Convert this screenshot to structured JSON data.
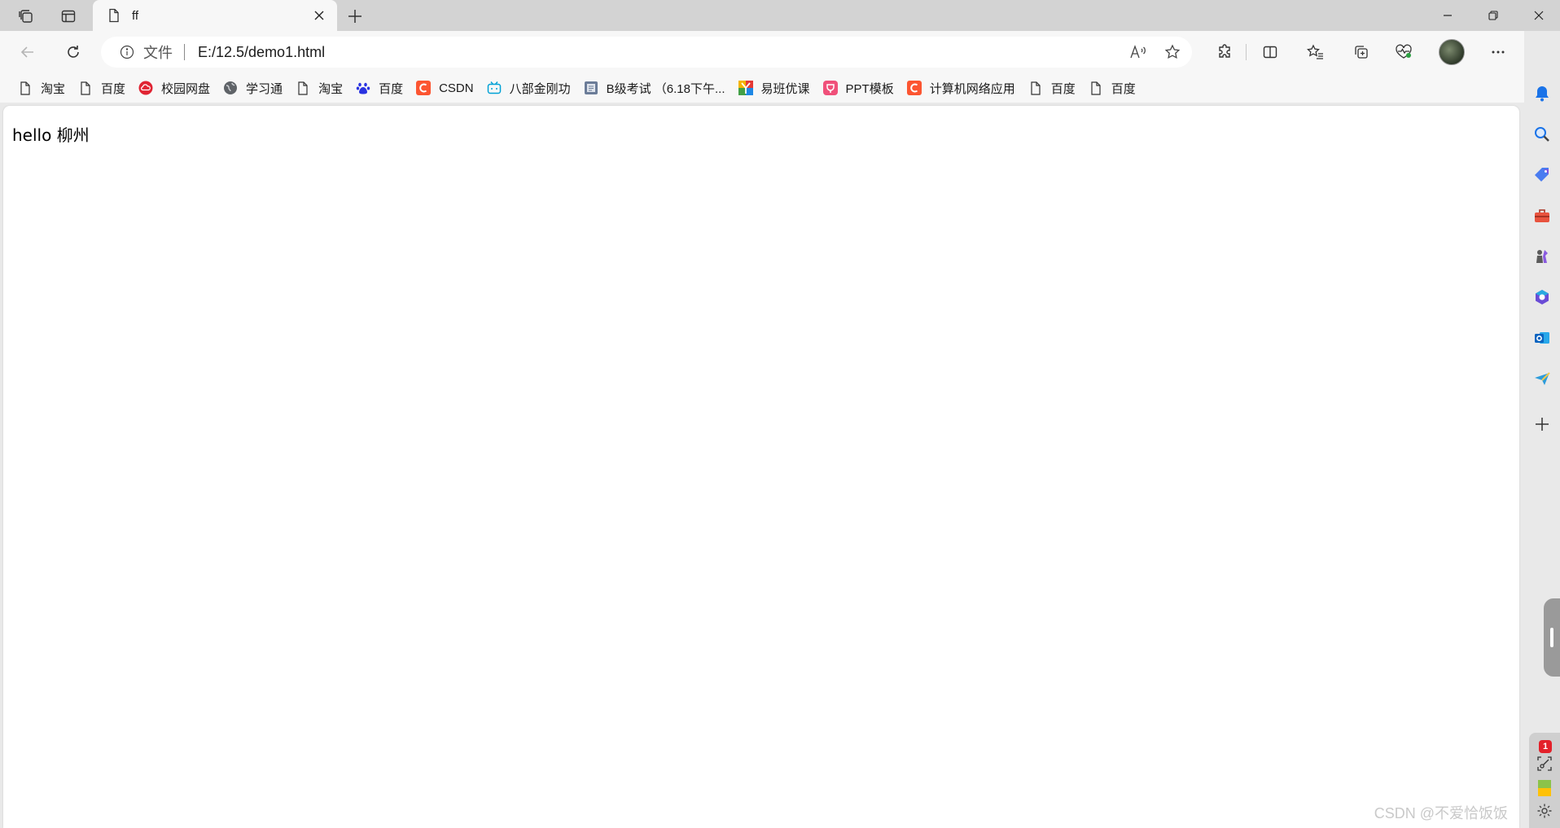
{
  "tab": {
    "title": "ff"
  },
  "address": {
    "scheme_label": "文件",
    "url": "E:/12.5/demo1.html"
  },
  "favorites": [
    {
      "label": "淘宝",
      "icon": "page-icon"
    },
    {
      "label": "百度",
      "icon": "page-icon"
    },
    {
      "label": "校园网盘",
      "icon": "cloud-disk-icon"
    },
    {
      "label": "学习通",
      "icon": "globe-icon"
    },
    {
      "label": "淘宝",
      "icon": "page-icon"
    },
    {
      "label": "百度",
      "icon": "baidu-paw-icon"
    },
    {
      "label": "CSDN",
      "icon": "csdn-icon"
    },
    {
      "label": "八部金刚功",
      "icon": "bilibili-icon"
    },
    {
      "label": "B级考试 （6.18下午...",
      "icon": "exam-icon"
    },
    {
      "label": "易班优课",
      "icon": "yiban-icon"
    },
    {
      "label": "PPT模板",
      "icon": "ppt-template-icon"
    },
    {
      "label": "计算机网络应用",
      "icon": "csdn-icon"
    },
    {
      "label": "百度",
      "icon": "page-icon"
    },
    {
      "label": "百度",
      "icon": "page-icon"
    }
  ],
  "page": {
    "body_text": "hello 柳州"
  },
  "watermark": "CSDN @不爱恰饭饭",
  "sidebar": {
    "badge_count": "1"
  },
  "colors": {
    "accent": "#0067c0",
    "csdn": "#fc5531",
    "bilibili": "#00a1d6",
    "badge": "#e3212a"
  }
}
